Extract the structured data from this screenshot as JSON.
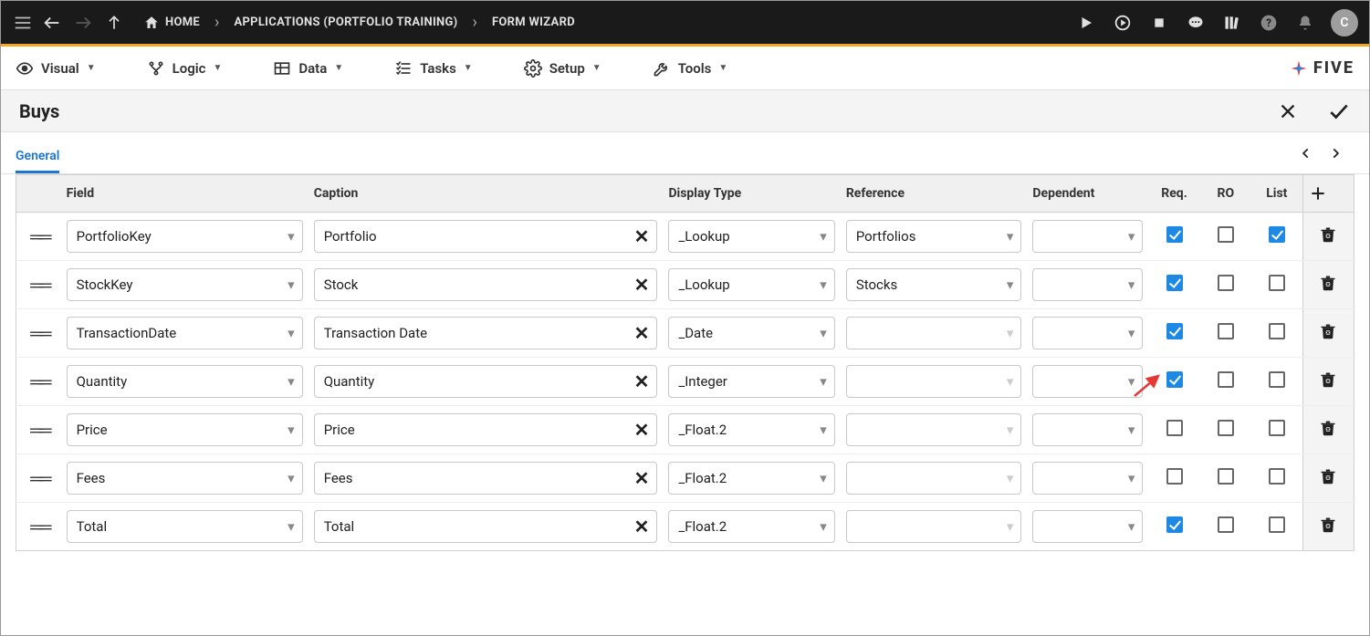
{
  "topbar": {
    "menu_icon": "menu",
    "breadcrumbs": [
      {
        "key": "home",
        "label": "HOME",
        "hasHomeIcon": true
      },
      {
        "key": "apps",
        "label": "APPLICATIONS (PORTFOLIO TRAINING)"
      },
      {
        "key": "wizard",
        "label": "FORM WIZARD"
      }
    ],
    "avatar_initial": "C"
  },
  "menubar": {
    "items": [
      {
        "key": "visual",
        "label": "Visual"
      },
      {
        "key": "logic",
        "label": "Logic"
      },
      {
        "key": "data",
        "label": "Data"
      },
      {
        "key": "tasks",
        "label": "Tasks"
      },
      {
        "key": "setup",
        "label": "Setup"
      },
      {
        "key": "tools",
        "label": "Tools"
      }
    ],
    "brand": "FIVE"
  },
  "titlebar": {
    "title": "Buys"
  },
  "tabs": {
    "active": "General"
  },
  "table": {
    "headers": {
      "field": "Field",
      "caption": "Caption",
      "dtype": "Display Type",
      "ref": "Reference",
      "dep": "Dependent",
      "req": "Req.",
      "ro": "RO",
      "list": "List"
    },
    "rows": [
      {
        "field": "PortfolioKey",
        "caption": "Portfolio",
        "dtype": "_Lookup",
        "ref": "Portfolios",
        "dep": "",
        "req": true,
        "ro": false,
        "list": true
      },
      {
        "field": "StockKey",
        "caption": "Stock",
        "dtype": "_Lookup",
        "ref": "Stocks",
        "dep": "",
        "req": true,
        "ro": false,
        "list": false
      },
      {
        "field": "TransactionDate",
        "caption": "Transaction Date",
        "dtype": "_Date",
        "ref": "",
        "dep": "",
        "req": true,
        "ro": false,
        "list": false
      },
      {
        "field": "Quantity",
        "caption": "Quantity",
        "dtype": "_Integer",
        "ref": "",
        "dep": "",
        "req": true,
        "ro": false,
        "list": false
      },
      {
        "field": "Price",
        "caption": "Price",
        "dtype": "_Float.2",
        "ref": "",
        "dep": "",
        "req": false,
        "ro": false,
        "list": false
      },
      {
        "field": "Fees",
        "caption": "Fees",
        "dtype": "_Float.2",
        "ref": "",
        "dep": "",
        "req": false,
        "ro": false,
        "list": false
      },
      {
        "field": "Total",
        "caption": "Total",
        "dtype": "_Float.2",
        "ref": "",
        "dep": "",
        "req": true,
        "ro": false,
        "list": false
      }
    ]
  }
}
